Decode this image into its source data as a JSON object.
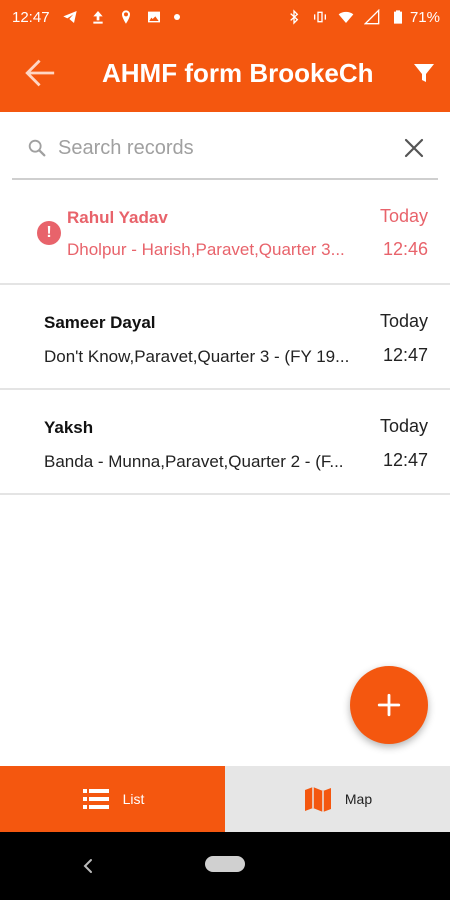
{
  "status_bar": {
    "time": "12:47",
    "battery": "71%",
    "left_icons": [
      "telegram-icon",
      "upload-icon",
      "location-icon",
      "image-icon",
      "dot-icon"
    ],
    "right_icons": [
      "bluetooth-icon",
      "vibrate-icon",
      "wifi-icon",
      "signal-icon",
      "battery-icon"
    ]
  },
  "app_bar": {
    "title": "AHMF form BrookeCh",
    "back_icon": "arrow-back-icon",
    "filter_icon": "filter-icon"
  },
  "search": {
    "placeholder": "Search records",
    "value": ""
  },
  "records": [
    {
      "name": "Rahul Yadav",
      "description": "Dholpur - Harish,Paravet,Quarter 3...",
      "day": "Today",
      "time": "12:46",
      "error": true
    },
    {
      "name": "Sameer Dayal",
      "description": "Don't Know,Paravet,Quarter 3 - (FY 19...",
      "day": "Today",
      "time": "12:47",
      "error": false
    },
    {
      "name": "Yaksh",
      "description": "Banda - Munna,Paravet,Quarter 2 - (F...",
      "day": "Today",
      "time": "12:47",
      "error": false
    }
  ],
  "error_mark": "!",
  "fab": {
    "icon": "plus-icon"
  },
  "bottom_nav": {
    "list_label": "List",
    "map_label": "Map",
    "active": "list"
  },
  "colors": {
    "primary": "#f4570f",
    "error": "#e8636b",
    "inactive_tab": "#e6e6e6"
  }
}
